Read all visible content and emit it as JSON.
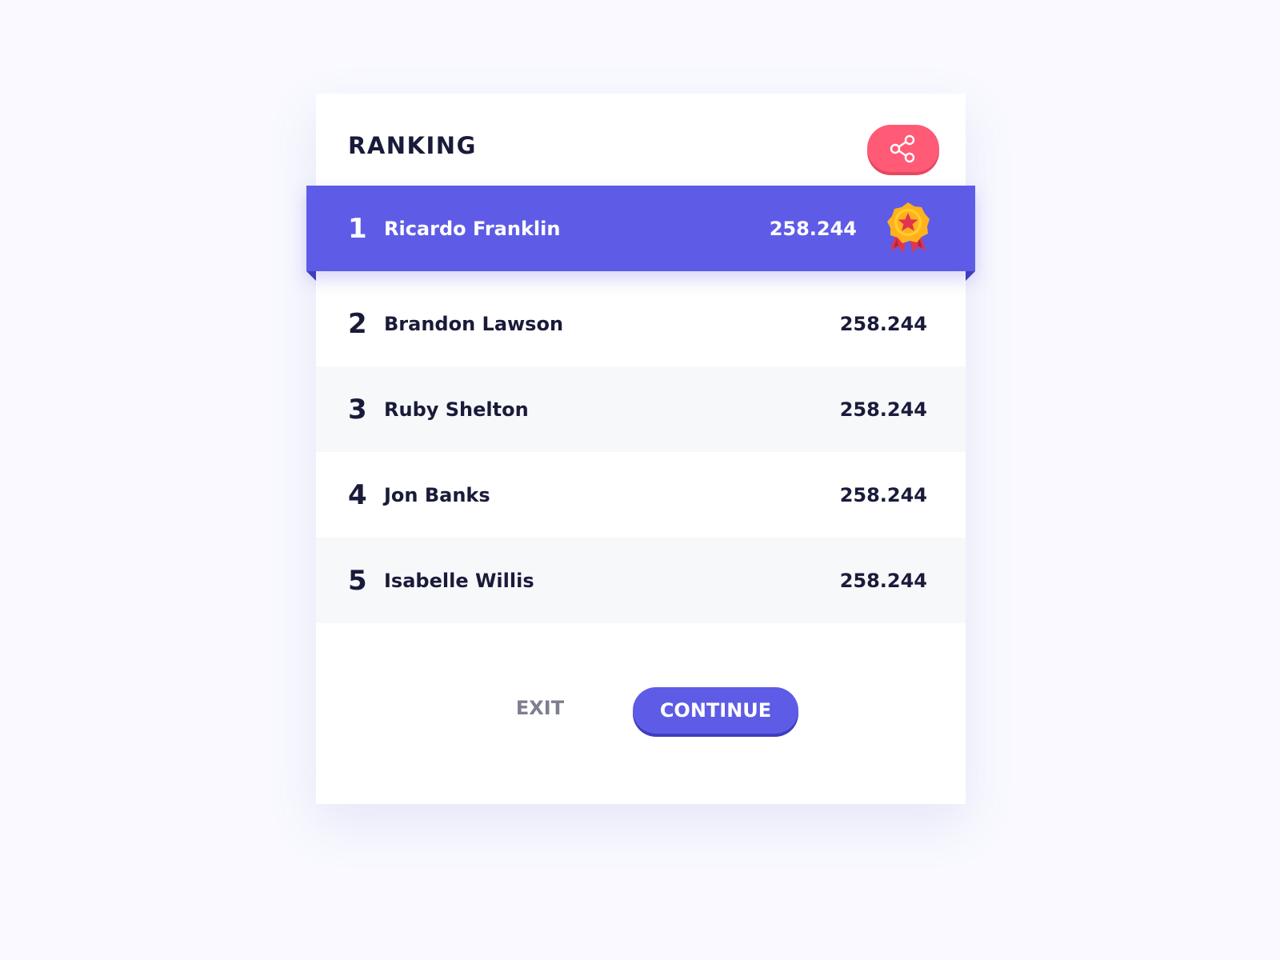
{
  "header": {
    "title": "RANKING",
    "share_icon": "share-icon"
  },
  "ranking": [
    {
      "rank": "1",
      "name": "Ricardo Franklin",
      "score": "258.244",
      "badge": "medal-star-icon"
    },
    {
      "rank": "2",
      "name": "Brandon Lawson",
      "score": "258.244"
    },
    {
      "rank": "3",
      "name": "Ruby Shelton",
      "score": "258.244"
    },
    {
      "rank": "4",
      "name": "Jon Banks",
      "score": "258.244"
    },
    {
      "rank": "5",
      "name": "Isabelle Willis",
      "score": "258.244"
    }
  ],
  "actions": {
    "exit_label": "EXIT",
    "continue_label": "CONTINUE"
  },
  "colors": {
    "accent": "#5e5ce6",
    "share": "#ff5a76",
    "text": "#1a1b3a",
    "muted": "#7d7f8f",
    "background": "#f9f9ff"
  }
}
